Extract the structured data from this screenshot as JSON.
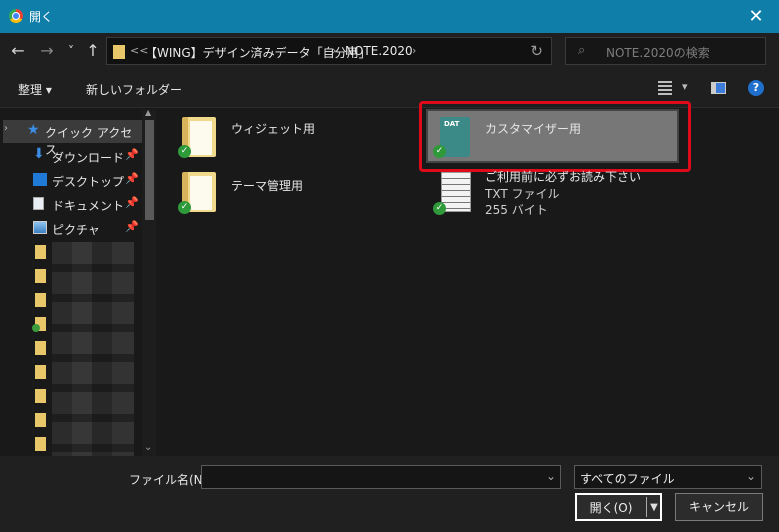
{
  "window": {
    "title": "開く"
  },
  "nav": {
    "back": "←",
    "forward": "→",
    "history": "˅",
    "up": "↑",
    "overflow": "<<",
    "breadcrumb": [
      "【WING】デザイン済みデータ「自分用」",
      "NOTE.2020"
    ],
    "search_placeholder": "NOTE.2020の検索"
  },
  "toolbar": {
    "organize": "整理",
    "new_folder": "新しいフォルダー",
    "help": "?"
  },
  "sidebar": {
    "quick_access": "クイック アクセス",
    "items": [
      {
        "label": "ダウンロード",
        "icon": "download-icon"
      },
      {
        "label": "デスクトップ",
        "icon": "desktop-icon"
      },
      {
        "label": "ドキュメント",
        "icon": "document-icon"
      },
      {
        "label": "ピクチャ",
        "icon": "picture-icon"
      }
    ]
  },
  "files": [
    {
      "name": "ウィジェット用",
      "type": "folder"
    },
    {
      "name": "テーマ管理用",
      "type": "folder"
    },
    {
      "name": "カスタマイザー用",
      "type": "folder",
      "selected": true
    },
    {
      "name": "ご利用前に必ずお読み下さい",
      "type": "txt",
      "detail1": "TXT ファイル",
      "detail2": "255 バイト"
    }
  ],
  "bottom": {
    "filename_label": "ファイル名(N):",
    "filename_value": "",
    "filter": "すべてのファイル",
    "open": "開く(O)",
    "cancel": "キャンセル"
  },
  "colors": {
    "titlebar": "#0f7fa9",
    "highlight": "#e00b1a"
  }
}
